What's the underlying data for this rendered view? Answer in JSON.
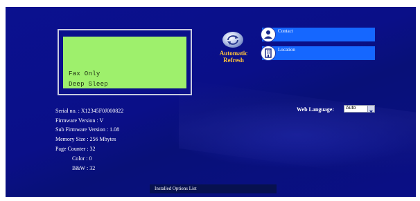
{
  "lcd": {
    "lines": [
      "Fax Only",
      "Deep Sleep"
    ]
  },
  "refresh": {
    "label_line1": "Automatic",
    "label_line2": "Refresh",
    "icon": "refresh-icon"
  },
  "nav": {
    "contact": {
      "label": "Contact",
      "icon": "person-icon"
    },
    "location": {
      "label": "Location",
      "icon": "building-icon"
    }
  },
  "info": {
    "serial": "Serial no. : X12345F0J000822",
    "firmware": "Firmware Version : V",
    "sub_firmware": "Sub Firmware Version : 1.08",
    "memory": "Memory Size : 256 Mbytes",
    "page_counter": "Page Counter : 32",
    "color": "Color : 0",
    "bw": "B&W : 32"
  },
  "web_language": {
    "label": "Web Language:",
    "selected": "Auto"
  },
  "installed_options": {
    "label": "Installed Options List"
  },
  "colors": {
    "background": "#0b118f",
    "lcd": "#9ef06c",
    "accent": "#ffc23a",
    "nav_button": "#1567ff"
  }
}
